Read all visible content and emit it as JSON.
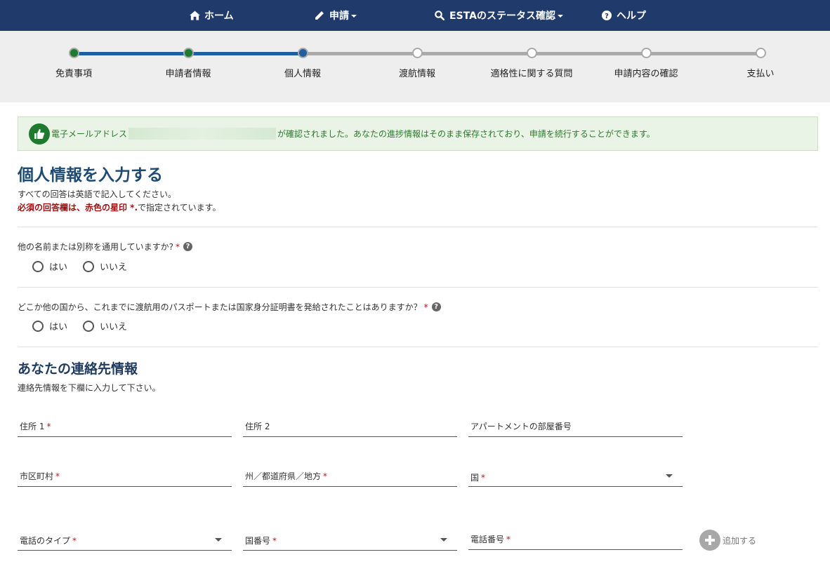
{
  "nav": {
    "home": "ホーム",
    "apply": "申請",
    "status": "ESTAのステータス確認",
    "help": "ヘルプ"
  },
  "steps": [
    {
      "label": "免責事項",
      "state": "complete"
    },
    {
      "label": "申請者情報",
      "state": "complete"
    },
    {
      "label": "個人情報",
      "state": "current"
    },
    {
      "label": "渡航情報",
      "state": "pending"
    },
    {
      "label": "適格性に関する質問",
      "state": "pending"
    },
    {
      "label": "申請内容の確認",
      "state": "pending"
    },
    {
      "label": "支払い",
      "state": "pending"
    }
  ],
  "alert": {
    "prefix": "電子メールアドレス",
    "suffix": "が確認されました。あなたの進捗情報はそのまま保存されており、申請を続行することができます。"
  },
  "page": {
    "title": "個人情報を入力する",
    "note_english": "すべての回答は英語で記入してください。",
    "note_required_bold": "必須の回答欄は、赤色の星印 *.",
    "note_required_rest": "で指定されています。"
  },
  "questions": {
    "alias": "他の名前または別称を通用していますか?",
    "passport": "どこか他の国から、これまでに渡航用のパスポートまたは国家身分証明書を発給されたことはありますか？"
  },
  "options": {
    "yes": "はい",
    "no": "いいえ"
  },
  "contact": {
    "title": "あなたの連絡先情報",
    "subtitle": "連絡先情報を下欄に入力して下さい。"
  },
  "fields": {
    "address1": "住所 1",
    "address2": "住所 2",
    "apartment": "アパートメントの部屋番号",
    "city": "市区町村",
    "state": "州／都道府県／地方",
    "country": "国",
    "phone_type": "電話のタイプ",
    "country_code": "国番号",
    "phone_number": "電話番号"
  },
  "required_mark": "*",
  "help_mark": "?",
  "add_label": "追加する",
  "colors": {
    "navbar": "#1f3a6b",
    "step_complete": "#1e7a2e",
    "step_current": "#1f5fa0",
    "alert_bg": "#e9f4e6",
    "alert_text": "#2a7a2a",
    "title": "#1f4a72",
    "required": "#c0141a"
  }
}
